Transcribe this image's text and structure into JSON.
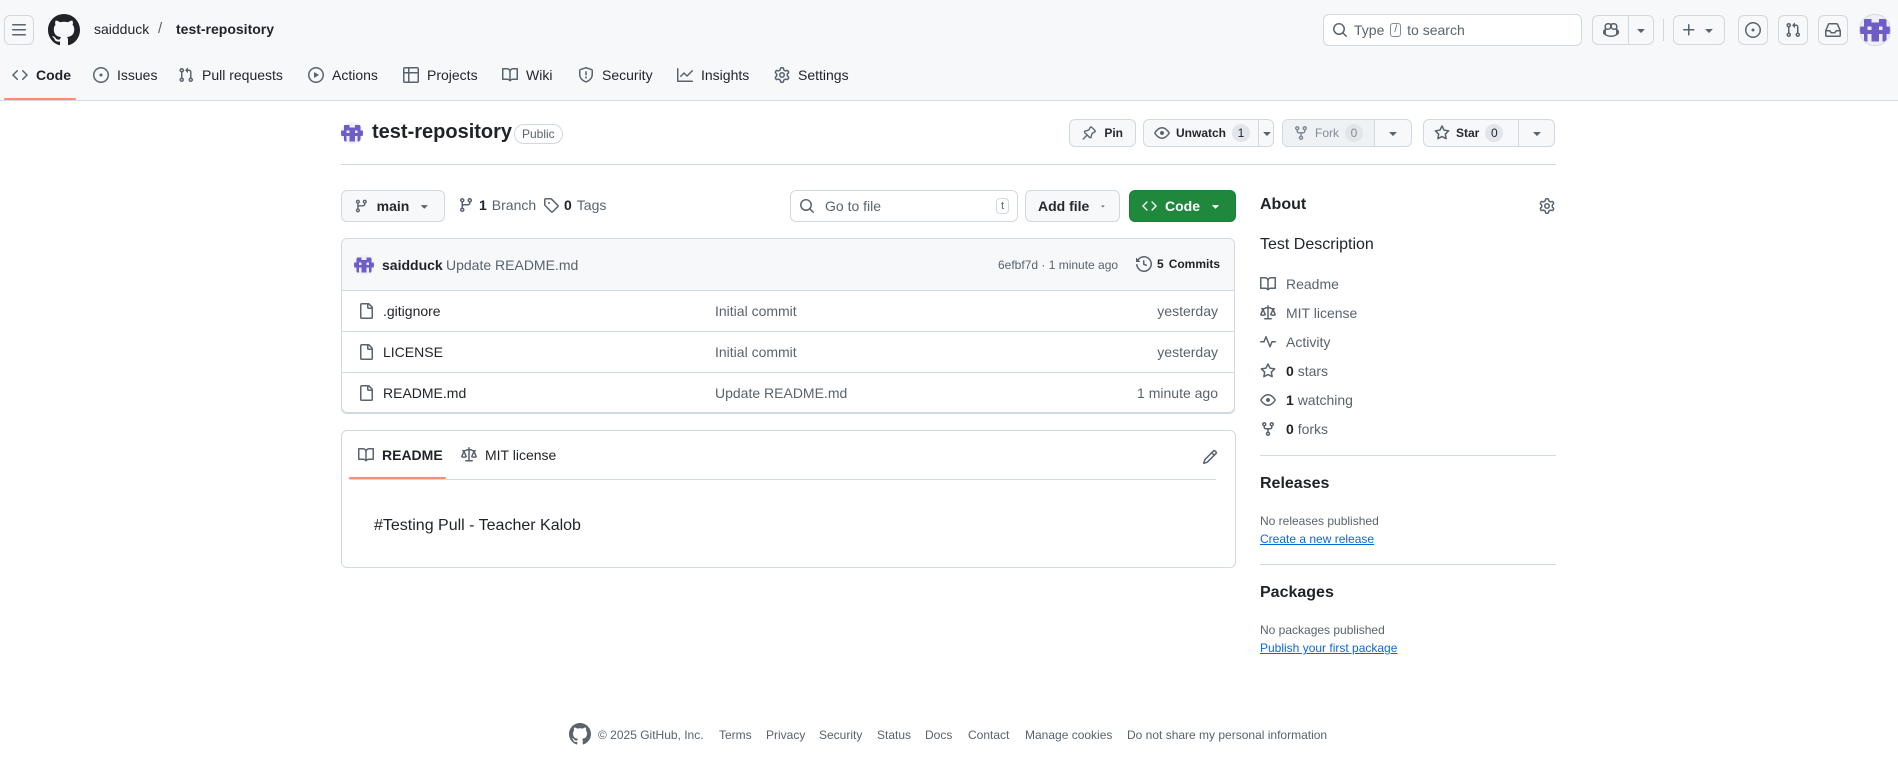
{
  "header": {
    "owner": "saidduck",
    "separator": "/",
    "repo": "test-repository",
    "search_prefix": "Type",
    "search_key": "/",
    "search_suffix": "to search"
  },
  "nav": {
    "tabs": [
      {
        "label": "Code",
        "icon": "code-icon",
        "active": true
      },
      {
        "label": "Issues",
        "icon": "issue-opened-icon"
      },
      {
        "label": "Pull requests",
        "icon": "git-pull-request-icon"
      },
      {
        "label": "Actions",
        "icon": "play-icon"
      },
      {
        "label": "Projects",
        "icon": "table-icon"
      },
      {
        "label": "Wiki",
        "icon": "book-icon"
      },
      {
        "label": "Security",
        "icon": "shield-icon"
      },
      {
        "label": "Insights",
        "icon": "graph-icon"
      },
      {
        "label": "Settings",
        "icon": "gear-icon"
      }
    ]
  },
  "repo_header": {
    "name": "test-repository",
    "visibility": "Public",
    "pin_label": "Pin",
    "unwatch_label": "Unwatch",
    "watch_count": "1",
    "fork_label": "Fork",
    "fork_count": "0",
    "star_label": "Star",
    "star_count": "0"
  },
  "toolbar": {
    "branch": "main",
    "branch_count": "1",
    "branch_label": "Branch",
    "tag_count": "0",
    "tag_label": "Tags",
    "goto_placeholder": "Go to file",
    "goto_key": "t",
    "add_file_label": "Add file",
    "code_label": "Code"
  },
  "commit": {
    "author": "saidduck",
    "message": "Update README.md",
    "sha_time": "6efbf7d · 1 minute ago",
    "commits_count": "5",
    "commits_label": "Commits"
  },
  "files": [
    {
      "name": ".gitignore",
      "message": "Initial commit",
      "date": "yesterday"
    },
    {
      "name": "LICENSE",
      "message": "Initial commit",
      "date": "yesterday"
    },
    {
      "name": "README.md",
      "message": "Update README.md",
      "date": "1 minute ago"
    }
  ],
  "readme": {
    "tab_readme": "README",
    "tab_license": "MIT license",
    "content": "#Testing Pull - Teacher Kalob"
  },
  "about": {
    "title": "About",
    "description": "Test Description",
    "readme": "Readme",
    "license": "MIT license",
    "activity": "Activity",
    "stars_count": "0",
    "stars_label": "stars",
    "watching_count": "1",
    "watching_label": "watching",
    "forks_count": "0",
    "forks_label": "forks"
  },
  "releases": {
    "title": "Releases",
    "note": "No releases published",
    "link": "Create a new release"
  },
  "packages": {
    "title": "Packages",
    "note": "No packages published",
    "link": "Publish your first package"
  },
  "footer": {
    "copyright": "© 2025 GitHub, Inc.",
    "links": [
      "Terms",
      "Privacy",
      "Security",
      "Status",
      "Docs",
      "Contact",
      "Manage cookies",
      "Do not share my personal information"
    ]
  },
  "colors": {
    "accent_green": "#1f883d",
    "link_blue": "#0969da",
    "active_tab_underline": "#fd8c73",
    "header_bg": "#f6f8fa",
    "avatar_purple": "#6e5cc7"
  }
}
